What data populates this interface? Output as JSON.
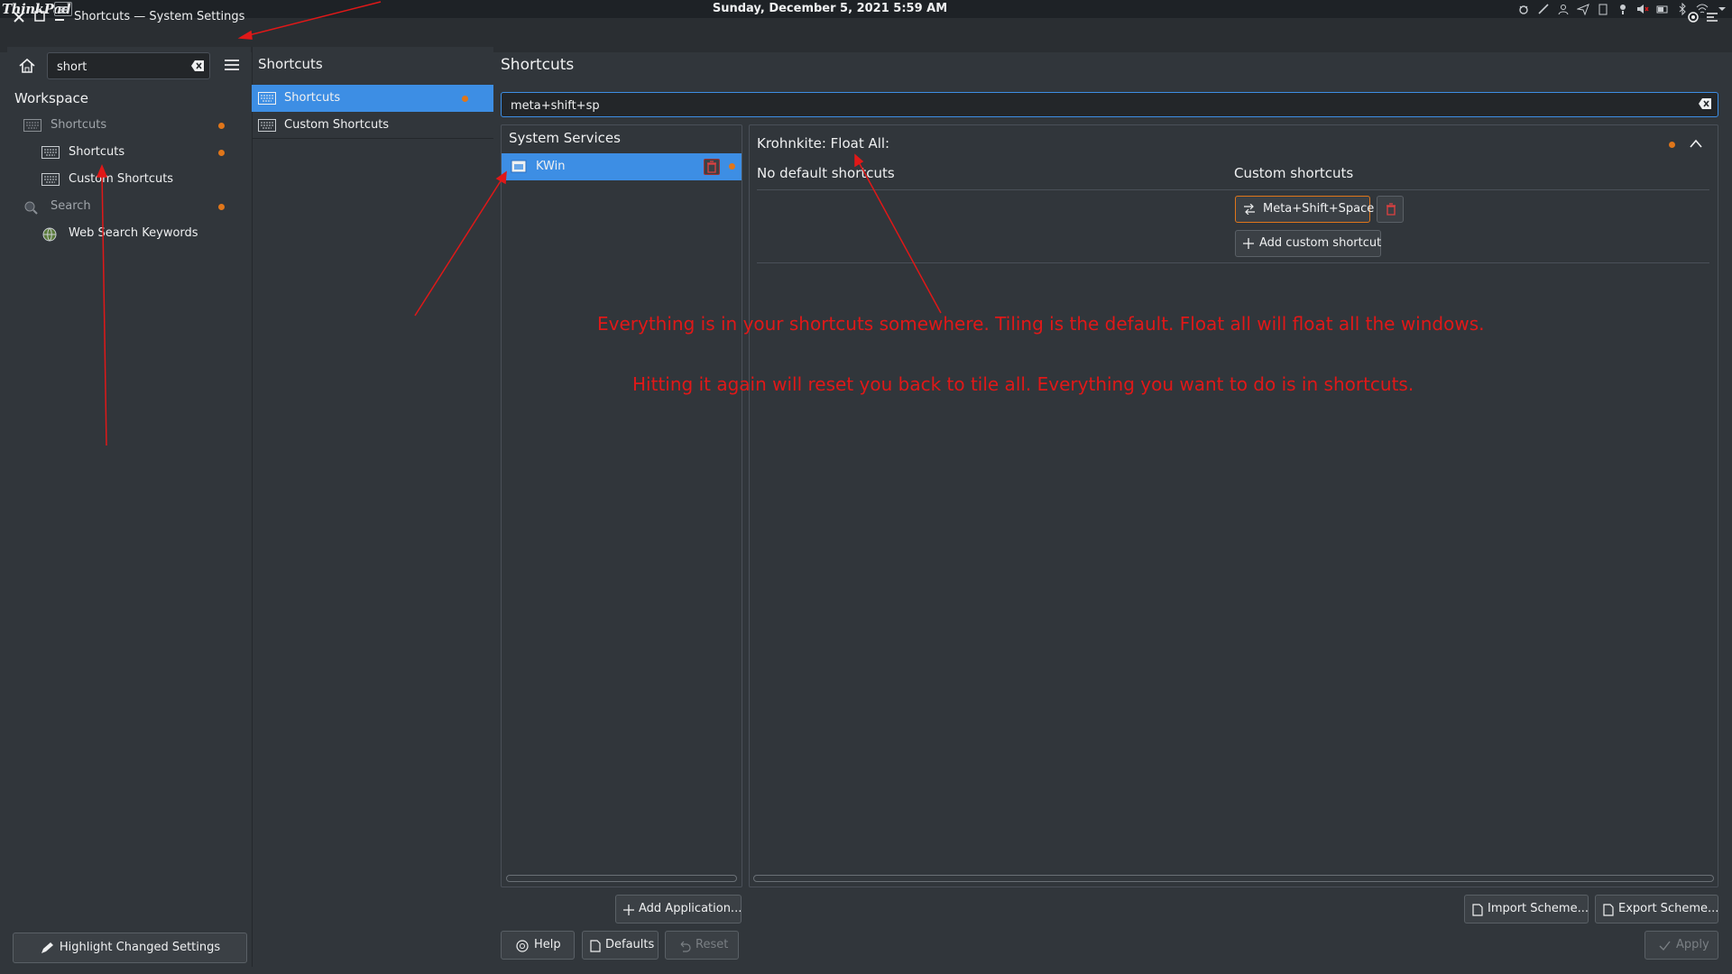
{
  "top_panel": {
    "logo": "ThinkPad",
    "clock": "Sunday, December 5, 2021   5:59 AM",
    "tray_icons": [
      "bug-icon",
      "ink-icon",
      "person-icon",
      "send-icon",
      "clipboard-icon",
      "light-icon",
      "speaker-muted-icon",
      "battery-icon",
      "bluetooth-icon",
      "wifi-icon",
      "chevron-down-icon"
    ]
  },
  "window": {
    "title": "Shortcuts — System Settings"
  },
  "sidebar": {
    "search_value": "short",
    "section_header": "Workspace",
    "items": [
      {
        "label": "Shortcuts"
      },
      {
        "label": "Shortcuts"
      },
      {
        "label": "Custom Shortcuts"
      },
      {
        "label": "Search"
      },
      {
        "label": "Web Search Keywords"
      }
    ],
    "highlight_button": "Highlight Changed Settings"
  },
  "middle": {
    "title": "Shortcuts",
    "items": [
      {
        "label": "Shortcuts"
      },
      {
        "label": "Custom Shortcuts"
      }
    ]
  },
  "main": {
    "title": "Shortcuts",
    "filter_value": "meta+shift+sp",
    "services_header": "System Services",
    "service_item": "KWin",
    "action_title": "Krohnkite: Float All:",
    "no_default": "No default shortcuts",
    "custom_header": "Custom shortcuts",
    "custom_shortcut": "Meta+Shift+Space",
    "add_custom": "Add custom shortcut",
    "add_application": "Add Application...",
    "import_scheme": "Import Scheme...",
    "export_scheme": "Export Scheme...",
    "help": "Help",
    "defaults": "Defaults",
    "reset": "Reset",
    "apply": "Apply"
  },
  "annotations": {
    "line1": "Everything is in your shortcuts somewhere.  Tiling is the default.  Float all will float all the windows.",
    "line2": "Hitting it again will reset you back to tile all.  Everything you want to do is in shortcuts."
  },
  "colors": {
    "accent": "#3d8ee4",
    "changed_dot": "#e0761a",
    "annotation": "#e01818",
    "background": "#31363b"
  }
}
